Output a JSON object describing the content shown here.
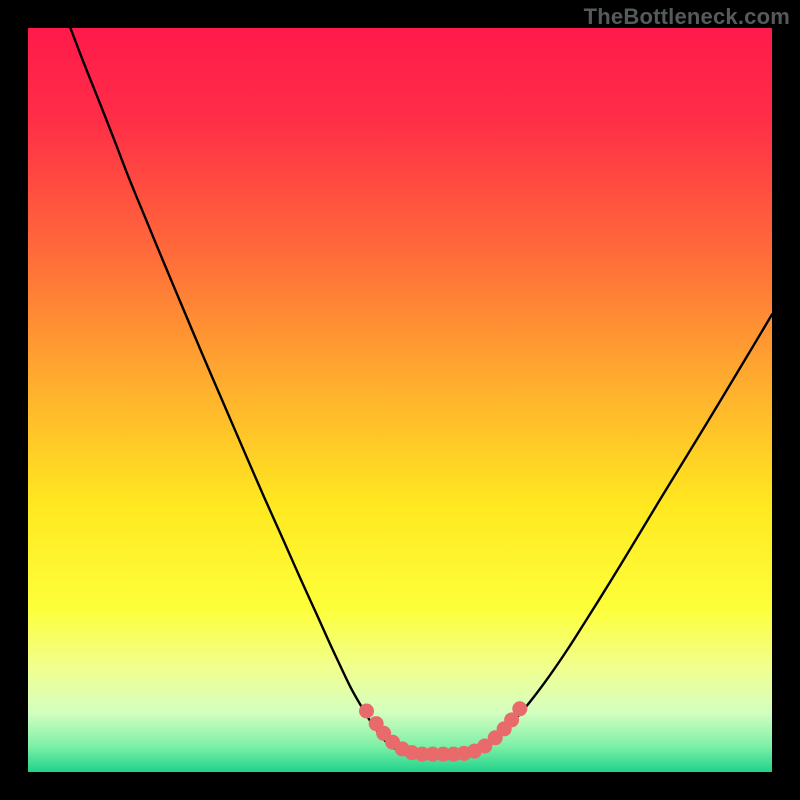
{
  "watermark": "TheBottleneck.com",
  "chart_data": {
    "type": "line",
    "title": "",
    "xlabel": "",
    "ylabel": "",
    "xlim": [
      0,
      1
    ],
    "ylim": [
      0,
      1
    ],
    "background_gradient": {
      "stops": [
        {
          "offset": 0.0,
          "color": "#ff1a4b"
        },
        {
          "offset": 0.12,
          "color": "#ff2d47"
        },
        {
          "offset": 0.3,
          "color": "#ff6a3a"
        },
        {
          "offset": 0.48,
          "color": "#ffae2e"
        },
        {
          "offset": 0.64,
          "color": "#ffe820"
        },
        {
          "offset": 0.78,
          "color": "#fdff3a"
        },
        {
          "offset": 0.86,
          "color": "#f1ff8f"
        },
        {
          "offset": 0.92,
          "color": "#d4ffc0"
        },
        {
          "offset": 0.965,
          "color": "#7ef0a8"
        },
        {
          "offset": 1.0,
          "color": "#20d28a"
        }
      ]
    },
    "series": [
      {
        "name": "left-curve",
        "stroke": "#000000",
        "stroke_width": 2.4,
        "points": [
          {
            "x": 0.057,
            "y": 1.0
          },
          {
            "x": 0.075,
            "y": 0.953
          },
          {
            "x": 0.095,
            "y": 0.903
          },
          {
            "x": 0.115,
            "y": 0.852
          },
          {
            "x": 0.135,
            "y": 0.8
          },
          {
            "x": 0.158,
            "y": 0.744
          },
          {
            "x": 0.182,
            "y": 0.686
          },
          {
            "x": 0.208,
            "y": 0.624
          },
          {
            "x": 0.235,
            "y": 0.56
          },
          {
            "x": 0.263,
            "y": 0.495
          },
          {
            "x": 0.291,
            "y": 0.43
          },
          {
            "x": 0.318,
            "y": 0.368
          },
          {
            "x": 0.344,
            "y": 0.31
          },
          {
            "x": 0.367,
            "y": 0.258
          },
          {
            "x": 0.388,
            "y": 0.212
          },
          {
            "x": 0.406,
            "y": 0.172
          },
          {
            "x": 0.421,
            "y": 0.14
          },
          {
            "x": 0.434,
            "y": 0.113
          },
          {
            "x": 0.447,
            "y": 0.09
          },
          {
            "x": 0.459,
            "y": 0.07
          },
          {
            "x": 0.47,
            "y": 0.054
          },
          {
            "x": 0.481,
            "y": 0.041
          },
          {
            "x": 0.492,
            "y": 0.032
          },
          {
            "x": 0.503,
            "y": 0.027
          },
          {
            "x": 0.512,
            "y": 0.025
          }
        ]
      },
      {
        "name": "flat-bottom",
        "stroke": "#000000",
        "stroke_width": 2.4,
        "points": [
          {
            "x": 0.512,
            "y": 0.025
          },
          {
            "x": 0.53,
            "y": 0.024
          },
          {
            "x": 0.55,
            "y": 0.024
          },
          {
            "x": 0.57,
            "y": 0.024
          },
          {
            "x": 0.586,
            "y": 0.025
          }
        ]
      },
      {
        "name": "right-curve",
        "stroke": "#000000",
        "stroke_width": 2.4,
        "points": [
          {
            "x": 0.586,
            "y": 0.025
          },
          {
            "x": 0.6,
            "y": 0.028
          },
          {
            "x": 0.616,
            "y": 0.036
          },
          {
            "x": 0.634,
            "y": 0.05
          },
          {
            "x": 0.654,
            "y": 0.07
          },
          {
            "x": 0.676,
            "y": 0.096
          },
          {
            "x": 0.7,
            "y": 0.128
          },
          {
            "x": 0.726,
            "y": 0.166
          },
          {
            "x": 0.754,
            "y": 0.21
          },
          {
            "x": 0.784,
            "y": 0.258
          },
          {
            "x": 0.815,
            "y": 0.309
          },
          {
            "x": 0.847,
            "y": 0.362
          },
          {
            "x": 0.88,
            "y": 0.416
          },
          {
            "x": 0.913,
            "y": 0.47
          },
          {
            "x": 0.945,
            "y": 0.523
          },
          {
            "x": 0.975,
            "y": 0.573
          },
          {
            "x": 1.0,
            "y": 0.615
          }
        ]
      }
    ],
    "markers": {
      "color": "#e96a6a",
      "radius_px": 7.5,
      "points": [
        {
          "x": 0.455,
          "y": 0.082
        },
        {
          "x": 0.468,
          "y": 0.065
        },
        {
          "x": 0.478,
          "y": 0.052
        },
        {
          "x": 0.49,
          "y": 0.04
        },
        {
          "x": 0.503,
          "y": 0.031
        },
        {
          "x": 0.516,
          "y": 0.026
        },
        {
          "x": 0.53,
          "y": 0.024
        },
        {
          "x": 0.544,
          "y": 0.024
        },
        {
          "x": 0.558,
          "y": 0.024
        },
        {
          "x": 0.572,
          "y": 0.024
        },
        {
          "x": 0.586,
          "y": 0.025
        },
        {
          "x": 0.6,
          "y": 0.028
        },
        {
          "x": 0.614,
          "y": 0.035
        },
        {
          "x": 0.628,
          "y": 0.046
        },
        {
          "x": 0.64,
          "y": 0.058
        },
        {
          "x": 0.65,
          "y": 0.07
        },
        {
          "x": 0.661,
          "y": 0.085
        }
      ]
    }
  }
}
